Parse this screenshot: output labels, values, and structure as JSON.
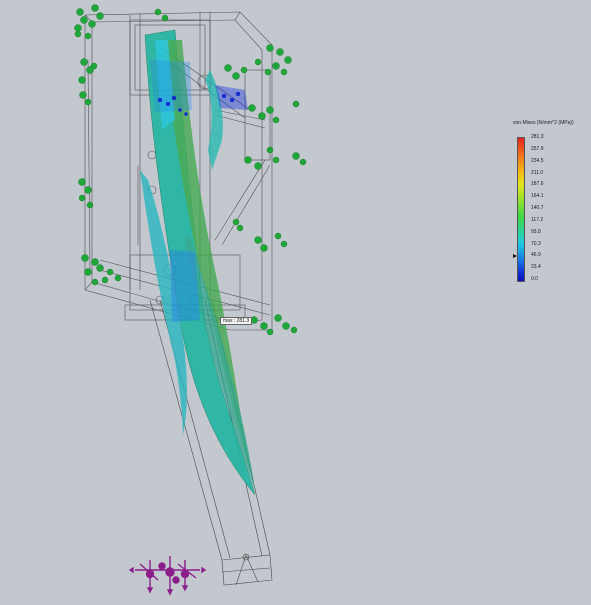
{
  "viewport": {
    "background": "#c3c8cf"
  },
  "legend": {
    "title": "von Mises (N/mm^2 (MPa))",
    "ticks": [
      "281.3",
      "257.9",
      "234.5",
      "211.0",
      "187.6",
      "164.1",
      "140.7",
      "117.2",
      "93.8",
      "70.3",
      "46.9",
      "23.4",
      "0.0"
    ],
    "colormap": [
      "#e8231f",
      "#f0711b",
      "#f4b81a",
      "#e3e51c",
      "#9fe32a",
      "#3ed642",
      "#2bd4a2",
      "#1fc8e2",
      "#1784e6",
      "#1230d9",
      "#0b0fb2"
    ],
    "pointer_value": 46.9
  },
  "annotation": {
    "max_label": "max : 281.3"
  },
  "scene": {
    "fixture_color": "#1fa83a",
    "load_color": "#8c1e8c",
    "frame_color": "#2a2a2a",
    "stress_colors": [
      "#1fc8a2",
      "#2bb6c0",
      "#3ea84a",
      "#1784e6"
    ],
    "icons": [
      "fixture-arrows-icon",
      "external-load-arrows-icon"
    ]
  }
}
